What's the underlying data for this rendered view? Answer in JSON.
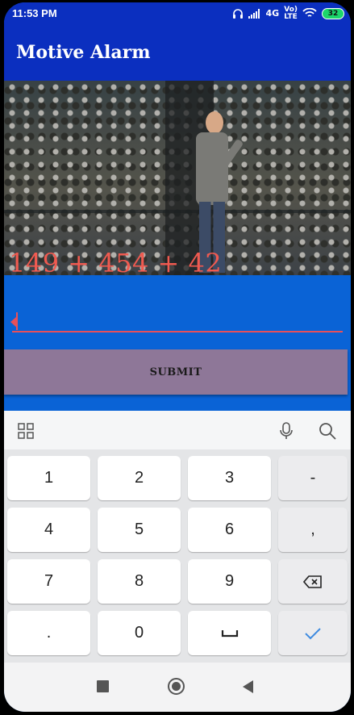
{
  "status_bar": {
    "time": "11:53 PM",
    "network": "4G",
    "volte_top": "Vo)",
    "volte_bottom": "LTE",
    "battery": "32"
  },
  "app_bar": {
    "title": "Motive Alarm"
  },
  "challenge": {
    "expression": "149 + 454 + 42"
  },
  "answer_input": {
    "value": ""
  },
  "submit_button": {
    "label": "SUBMIT"
  },
  "keyboard": {
    "toolbar": [
      "grid-icon",
      "mic-icon",
      "search-icon"
    ],
    "rows": [
      [
        "1",
        "2",
        "3",
        "-"
      ],
      [
        "4",
        "5",
        "6",
        ","
      ],
      [
        "7",
        "8",
        "9",
        "backspace-icon"
      ],
      [
        ".",
        "0",
        "space-icon",
        "check-icon"
      ]
    ],
    "accent_color": "#3f8be0"
  },
  "colors": {
    "status_bar": "#0b2fbf",
    "background": "#0a63d6",
    "expression_text": "#f05a50",
    "input_underline": "#e8505a",
    "submit_button": "#8e7798"
  },
  "nav_bar": [
    "recents-button",
    "home-button",
    "back-button"
  ]
}
